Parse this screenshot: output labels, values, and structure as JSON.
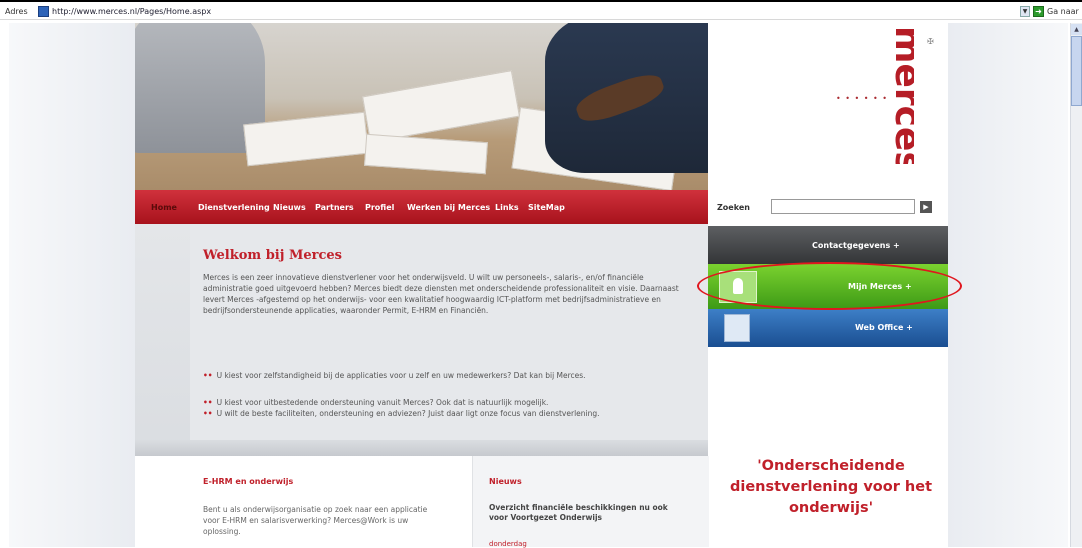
{
  "browser": {
    "address_label": "Adres",
    "url": "http://www.merces.nl/Pages/Home.aspx",
    "go_label": "Ga naar",
    "go_dropdown_icon": "chevron-down-icon",
    "go_button_icon": "go-arrow-icon"
  },
  "logo": {
    "text": "merces",
    "dots": "• • • • •   •"
  },
  "nav": {
    "items": [
      "Home",
      "Dienstverlening",
      "Nieuws",
      "Partners",
      "Profiel",
      "Werken bij Merces",
      "Links",
      "SiteMap"
    ]
  },
  "search": {
    "label": "Zoeken",
    "value": "",
    "button_icon": "search-go-icon"
  },
  "welcome": {
    "title": "Welkom bij Merces",
    "body": "Merces is een zeer innovatieve dienstverlener voor het onderwijsveld. U wilt uw personeels-, salaris-, en/of financiële administratie goed uitgevoerd hebben? Merces biedt deze diensten met onderscheidende professionaliteit en visie. Daarnaast levert Merces -afgestemd op het onderwijs- voor een kwalitatief hoogwaardig ICT-platform met bedrijfsadministratieve en bedrijfsondersteunende applicaties, waaronder Permit, E-HRM en Financiën.",
    "bullets": [
      "U kiest voor zelfstandigheid bij de applicaties voor u zelf en uw medewerkers? Dat kan bij Merces.",
      "U kiest voor uitbestedende ondersteuning vanuit Merces? Ook dat is natuurlijk mogelijk.",
      "U wilt de beste faciliteiten, ondersteuning en adviezen? Juist daar ligt onze focus van dienstverlening."
    ],
    "bullet_marker": "••"
  },
  "sidebar": {
    "contact": "Contactgegevens  +",
    "mijn": "Mijn Merces  +",
    "web": "Web Office  +",
    "quote": "'Onderscheidende dienstverlening voor het onderwijs'"
  },
  "ehrm": {
    "title": "E-HRM en onderwijs",
    "body": "Bent u als onderwijsorganisatie op zoek naar een applicatie voor E-HRM en salarisverwerking? Merces@Work is uw oplossing."
  },
  "news": {
    "title": "Nieuws",
    "item": "Overzicht financiële beschikkingen nu ook voor Voortgezet Onderwijs",
    "date": "donderdag"
  }
}
